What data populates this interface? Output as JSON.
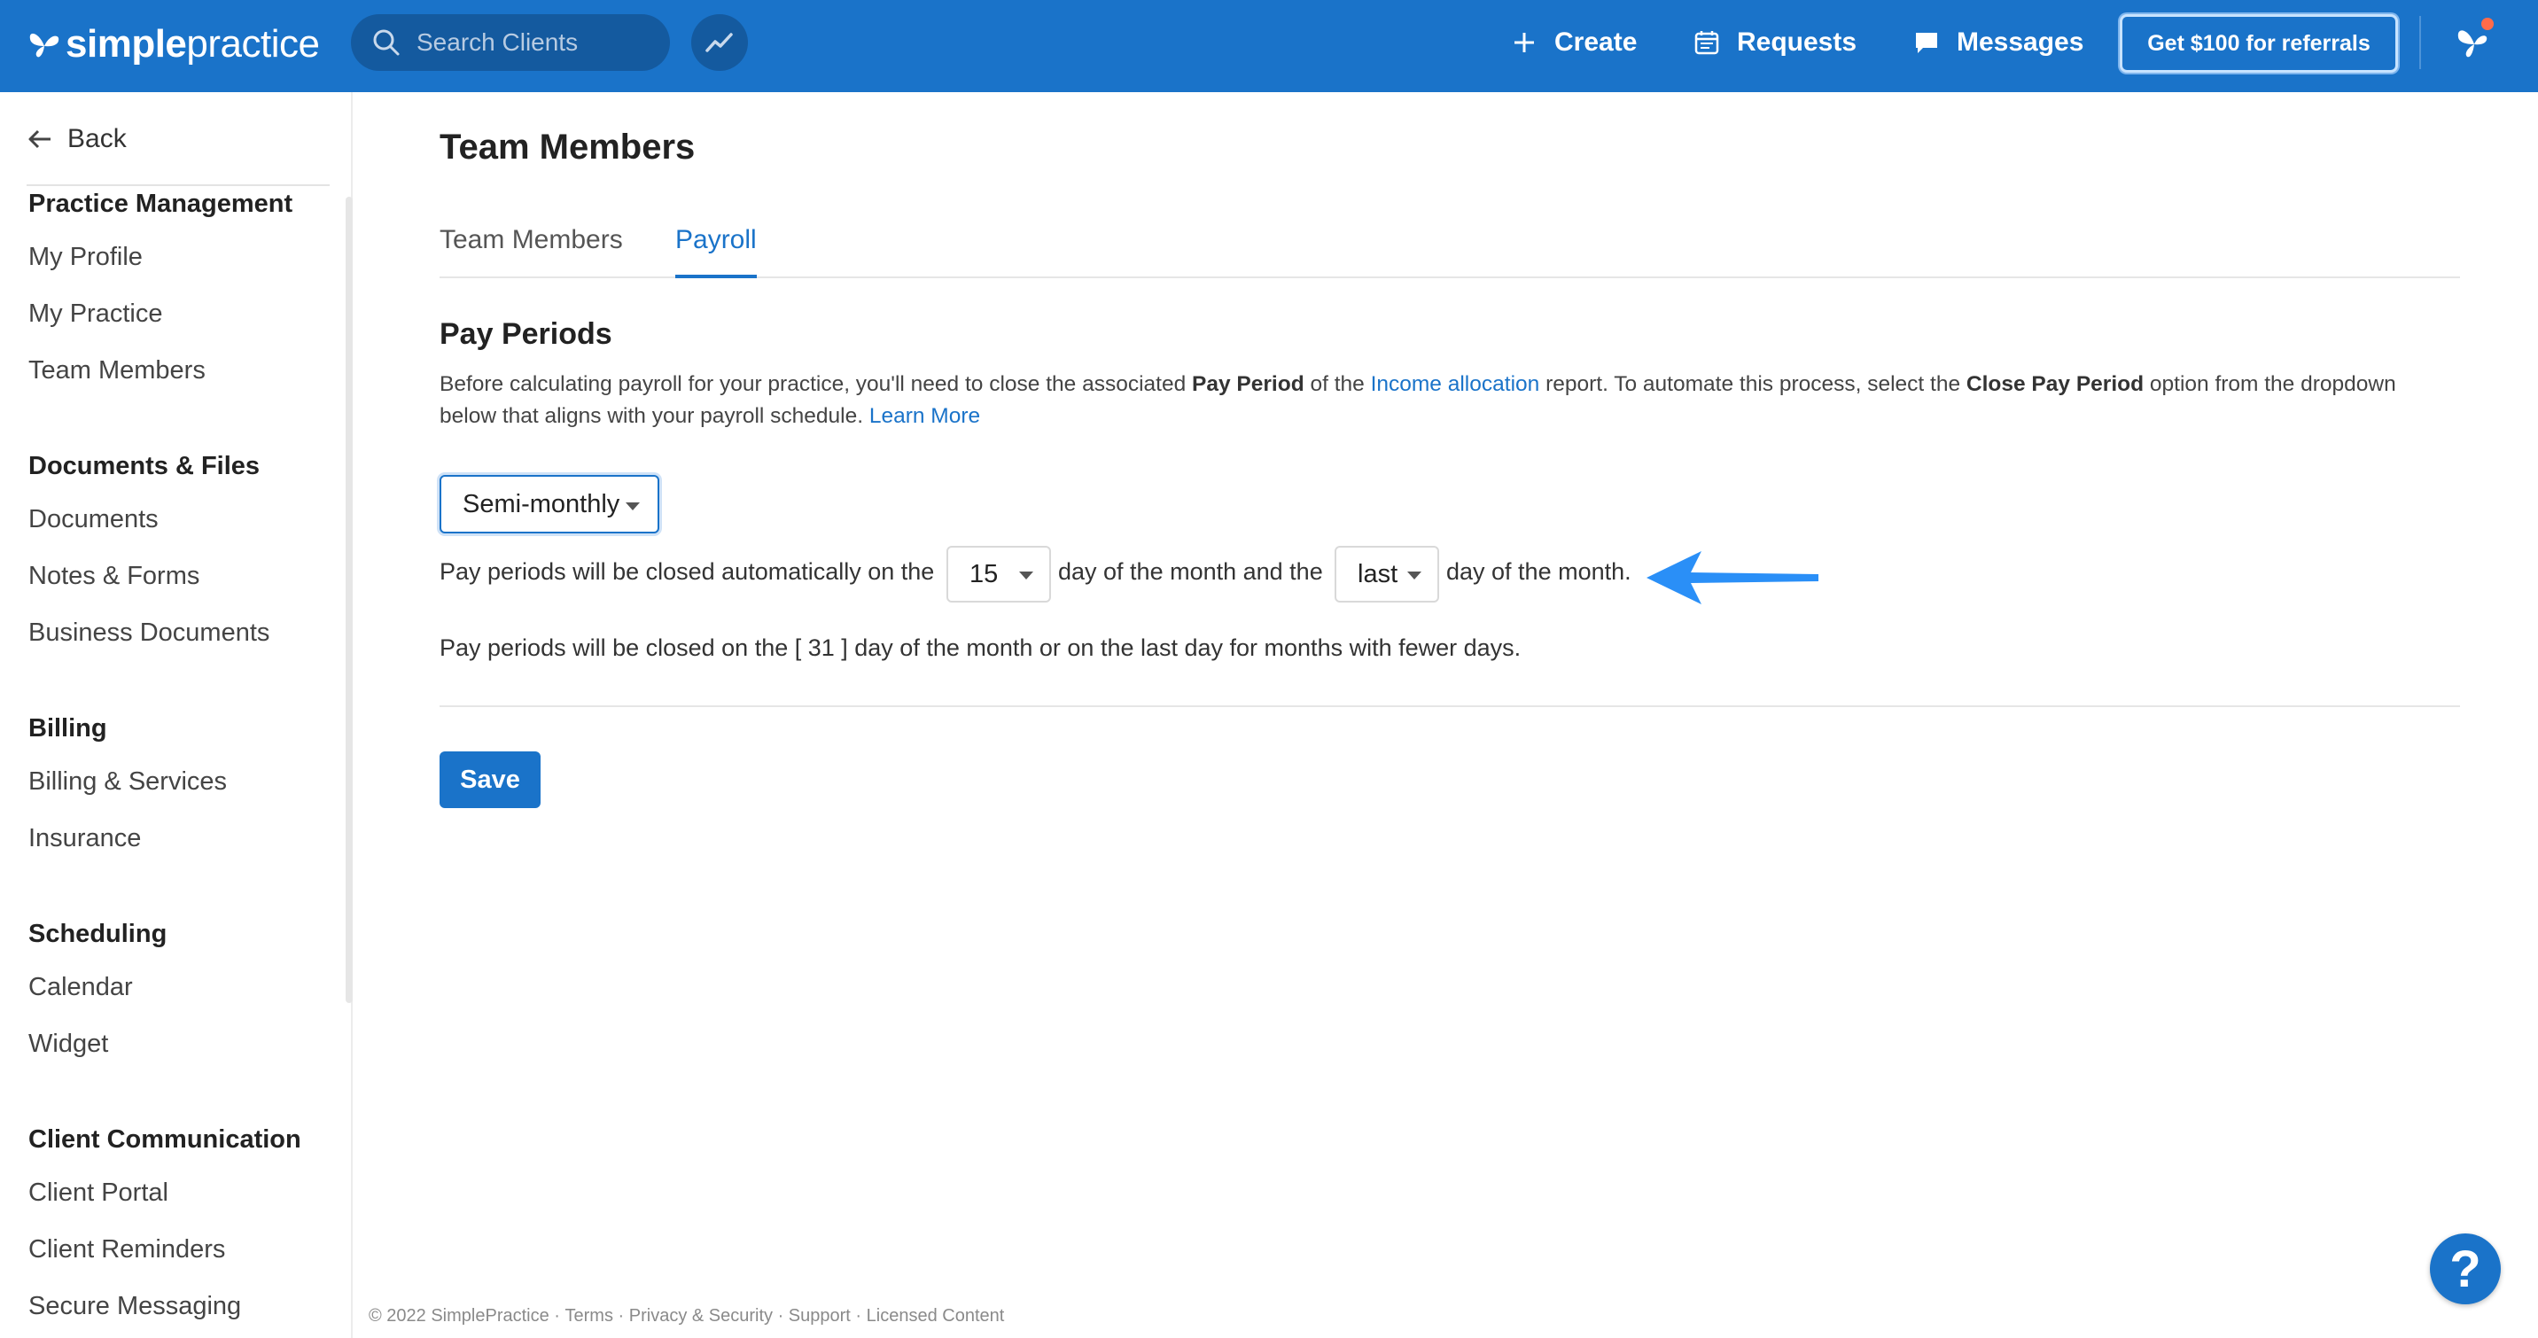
{
  "topbar": {
    "logo_bold": "simple",
    "logo_light": "practice",
    "search_placeholder": "Search Clients",
    "create_label": "Create",
    "requests_label": "Requests",
    "messages_label": "Messages",
    "referral_label": "Get $100 for referrals"
  },
  "sidebar": {
    "back_label": "Back",
    "sections": [
      {
        "title": "Practice Management",
        "items": [
          "My Profile",
          "My Practice",
          "Team Members"
        ]
      },
      {
        "title": "Documents & Files",
        "items": [
          "Documents",
          "Notes & Forms",
          "Business Documents"
        ]
      },
      {
        "title": "Billing",
        "items": [
          "Billing & Services",
          "Insurance"
        ]
      },
      {
        "title": "Scheduling",
        "items": [
          "Calendar",
          "Widget"
        ]
      },
      {
        "title": "Client Communication",
        "items": [
          "Client Portal",
          "Client Reminders",
          "Secure Messaging"
        ]
      }
    ]
  },
  "main": {
    "page_title": "Team Members",
    "tabs": [
      {
        "label": "Team Members",
        "active": false
      },
      {
        "label": "Payroll",
        "active": true
      }
    ],
    "section_title": "Pay Periods",
    "desc": {
      "p1": "Before calculating payroll for your practice, you'll need to close the associated ",
      "b1": "Pay Period",
      "p2": " of the ",
      "link1": "Income allocation",
      "p3": " report. To automate this process, select the ",
      "b2": "Close Pay Period",
      "p4": " option from the dropdown below that aligns with your payroll schedule. ",
      "link2": "Learn More"
    },
    "frequency_value": "Semi-monthly",
    "row_prefix": "Pay periods will be closed automatically on the",
    "first_day_value": "15",
    "row_middle": "day of the month and the",
    "second_day_value": "last",
    "row_suffix": "day of the month.",
    "note": "Pay periods will be closed on the [ 31 ] day of the month or on the last day for months with fewer days.",
    "save_label": "Save"
  },
  "footer": {
    "copyright": "© 2022 SimplePractice",
    "links": [
      "Terms",
      "Privacy & Security",
      "Support",
      "Licensed Content"
    ]
  },
  "help_label": "?",
  "colors": {
    "brand_blue": "#1a73c9",
    "nav_dark": "#145a9f",
    "annotation_arrow": "#2a8ff7",
    "notification_dot": "#ff6b4a"
  }
}
